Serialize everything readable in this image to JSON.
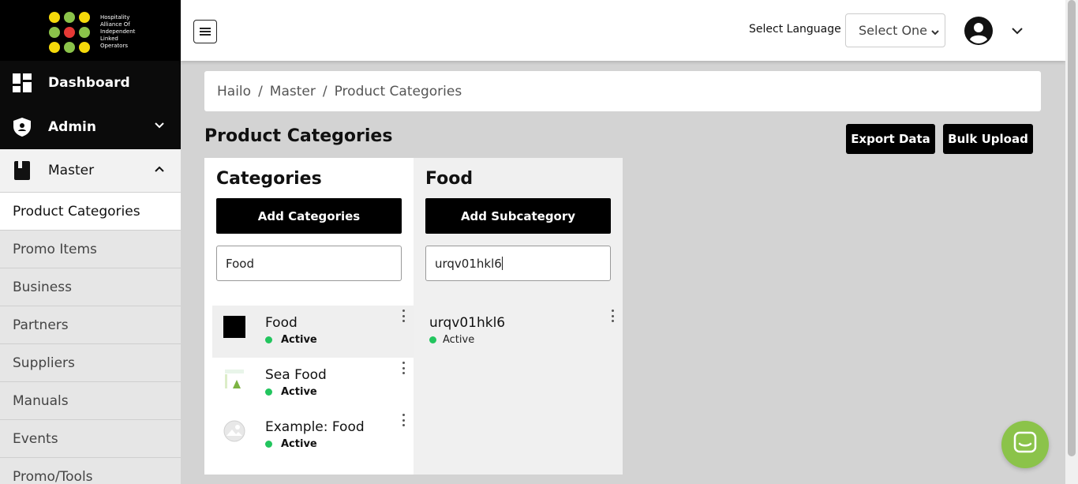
{
  "brand": {
    "logo_text_lines": [
      "Hospitality",
      "Alliance Of",
      "Independent",
      "Linked",
      "Operators"
    ],
    "colors": {
      "yellow": "#f5d90a",
      "green": "#8bc34a",
      "red": "#e53935"
    }
  },
  "sidebar": {
    "dashboard_label": "Dashboard",
    "admin_label": "Admin",
    "master_label": "Master",
    "items": [
      {
        "label": "Product Categories",
        "active": true
      },
      {
        "label": "Promo Items"
      },
      {
        "label": "Business"
      },
      {
        "label": "Partners"
      },
      {
        "label": "Suppliers"
      },
      {
        "label": "Manuals"
      },
      {
        "label": "Events"
      },
      {
        "label": "Promo/Tools"
      }
    ]
  },
  "topbar": {
    "language_label": "Select Language",
    "language_select_value": "Select One"
  },
  "breadcrumb": {
    "items": [
      "Hailo",
      "Master",
      "Product Categories"
    ],
    "separator": "/"
  },
  "page": {
    "title": "Product Categories",
    "export_label": "Export Data",
    "bulk_upload_label": "Bulk Upload"
  },
  "categories": {
    "title": "Categories",
    "add_label": "Add Categories",
    "search_value": "Food",
    "list": [
      {
        "name": "Food",
        "status": "Active",
        "thumb": "black-square"
      },
      {
        "name": "Sea Food",
        "status": "Active",
        "thumb": "image-thumbnail"
      },
      {
        "name": "Example: Food",
        "status": "Active",
        "thumb": "placeholder-image"
      }
    ]
  },
  "subcategories": {
    "title": "Food",
    "add_label": "Add Subcategory",
    "search_value": "urqv01hkl6",
    "list": [
      {
        "name": "urqv01hkl6",
        "status": "Active"
      }
    ]
  },
  "colors": {
    "active_dot": "#22c55e",
    "chat_bubble": "#8bc34a",
    "primary_button": "#000000"
  }
}
